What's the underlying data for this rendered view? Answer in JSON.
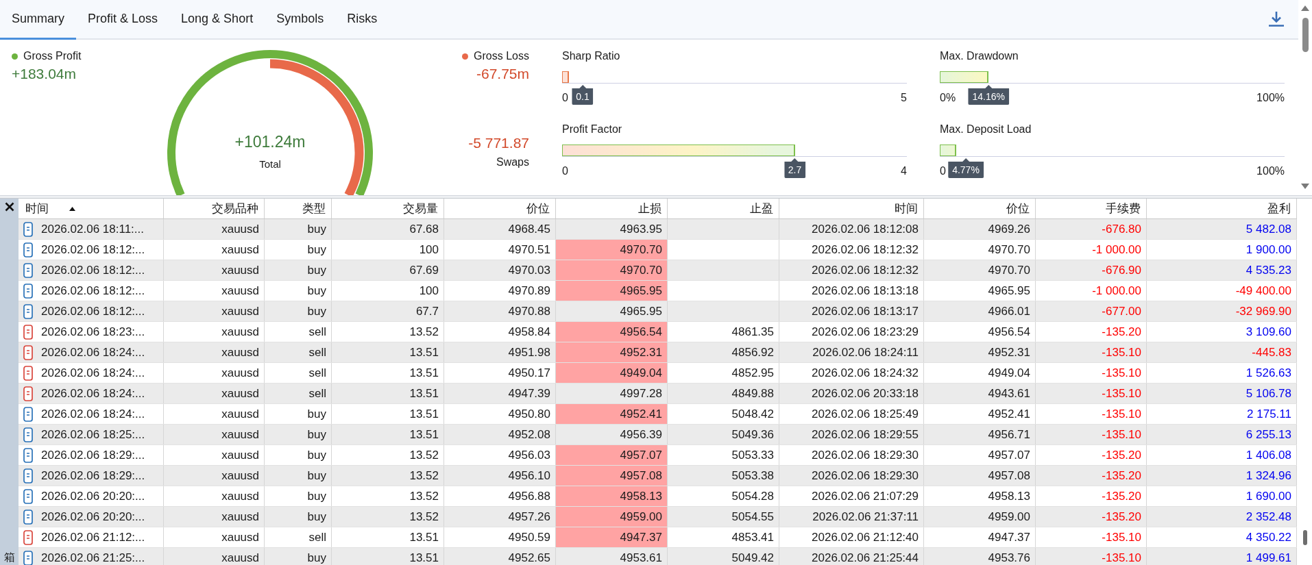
{
  "tabs": [
    {
      "label": "Summary",
      "selected": true
    },
    {
      "label": "Profit & Loss",
      "selected": false
    },
    {
      "label": "Long & Short",
      "selected": false
    },
    {
      "label": "Symbols",
      "selected": false
    },
    {
      "label": "Risks",
      "selected": false
    }
  ],
  "summary": {
    "gross_profit": {
      "label": "Gross Profit",
      "value": "+183.04m"
    },
    "total": {
      "value": "+101.24m",
      "label": "Total"
    },
    "gross_loss": {
      "label": "Gross Loss",
      "value": "-67.75m"
    },
    "swaps": {
      "value": "-5 771.87",
      "label": "Swaps"
    }
  },
  "metrics": [
    {
      "label": "Sharp Ratio",
      "kind": "higher_better",
      "level": 0.02,
      "value": "0.1",
      "min": "0",
      "max": "5"
    },
    {
      "label": "Max. Drawdown",
      "kind": "lower_better",
      "level": 0.1416,
      "value": "14.16%",
      "min": "0%",
      "max": "100%"
    },
    {
      "label": "Profit Factor",
      "kind": "higher_better",
      "level": 0.675,
      "value": "2.7",
      "min": "0",
      "max": "4"
    },
    {
      "label": "Max. Deposit Load",
      "kind": "lower_better",
      "level": 0.0477,
      "value": "4.77%",
      "min": "0",
      "max": "100%"
    }
  ],
  "side_panel": {
    "label": "箱"
  },
  "table": {
    "columns": [
      {
        "label": "时间",
        "sorted": true
      },
      {
        "label": "交易品种",
        "sorted": false
      },
      {
        "label": "类型",
        "sorted": false
      },
      {
        "label": "交易量",
        "sorted": false
      },
      {
        "label": "价位",
        "sorted": false
      },
      {
        "label": "止损",
        "sorted": false
      },
      {
        "label": "止盈",
        "sorted": false
      },
      {
        "label": "时间",
        "sorted": false
      },
      {
        "label": "价位",
        "sorted": false
      },
      {
        "label": "手续费",
        "sorted": false
      },
      {
        "label": "盈利",
        "sorted": false
      }
    ],
    "rows": [
      {
        "kind": "buy",
        "time": "2026.02.06 18:11:...",
        "symbol": "xauusd",
        "type": "buy",
        "volume": "67.68",
        "price": "4968.45",
        "sl": "4963.95",
        "sl_hit": false,
        "close_time": "2026.02.06 18:12:08",
        "close_price": "4969.26",
        "commission": "-676.80",
        "profit": "5 482.08",
        "loss": false
      },
      {
        "kind": "buy",
        "time": "2026.02.06 18:12:...",
        "symbol": "xauusd",
        "type": "buy",
        "volume": "100",
        "price": "4970.51",
        "sl": "4970.70",
        "sl_hit": true,
        "close_time": "2026.02.06 18:12:32",
        "close_price": "4970.70",
        "commission": "-1 000.00",
        "profit": "1 900.00",
        "loss": false
      },
      {
        "kind": "buy",
        "time": "2026.02.06 18:12:...",
        "symbol": "xauusd",
        "type": "buy",
        "volume": "67.69",
        "price": "4970.03",
        "sl": "4970.70",
        "sl_hit": true,
        "close_time": "2026.02.06 18:12:32",
        "close_price": "4970.70",
        "commission": "-676.90",
        "profit": "4 535.23",
        "loss": false
      },
      {
        "kind": "buy",
        "time": "2026.02.06 18:12:...",
        "symbol": "xauusd",
        "type": "buy",
        "volume": "100",
        "price": "4970.89",
        "sl": "4965.95",
        "sl_hit": true,
        "close_time": "2026.02.06 18:13:18",
        "close_price": "4965.95",
        "commission": "-1 000.00",
        "profit": "-49 400.00",
        "loss": true
      },
      {
        "kind": "buy",
        "time": "2026.02.06 18:12:...",
        "symbol": "xauusd",
        "type": "buy",
        "volume": "67.7",
        "price": "4970.88",
        "sl": "4965.95",
        "sl_hit": false,
        "close_time": "2026.02.06 18:13:17",
        "close_price": "4966.01",
        "commission": "-677.00",
        "profit": "-32 969.90",
        "loss": true
      },
      {
        "kind": "sell",
        "time": "2026.02.06 18:23:...",
        "symbol": "xauusd",
        "type": "sell",
        "volume": "13.52",
        "price": "4958.84",
        "sl": "4956.54",
        "sl_hit": true,
        "tp": "4861.35",
        "close_time": "2026.02.06 18:23:29",
        "close_price": "4956.54",
        "commission": "-135.20",
        "profit": "3 109.60",
        "loss": false
      },
      {
        "kind": "sell",
        "time": "2026.02.06 18:24:...",
        "symbol": "xauusd",
        "type": "sell",
        "volume": "13.51",
        "price": "4951.98",
        "sl": "4952.31",
        "sl_hit": true,
        "tp": "4856.92",
        "close_time": "2026.02.06 18:24:11",
        "close_price": "4952.31",
        "commission": "-135.10",
        "profit": "-445.83",
        "loss": true
      },
      {
        "kind": "sell",
        "time": "2026.02.06 18:24:...",
        "symbol": "xauusd",
        "type": "sell",
        "volume": "13.51",
        "price": "4950.17",
        "sl": "4949.04",
        "sl_hit": true,
        "tp": "4852.95",
        "close_time": "2026.02.06 18:24:32",
        "close_price": "4949.04",
        "commission": "-135.10",
        "profit": "1 526.63",
        "loss": false
      },
      {
        "kind": "sell",
        "time": "2026.02.06 18:24:...",
        "symbol": "xauusd",
        "type": "sell",
        "volume": "13.51",
        "price": "4947.39",
        "sl": "4997.28",
        "sl_hit": false,
        "tp": "4849.88",
        "close_time": "2026.02.06 20:33:18",
        "close_price": "4943.61",
        "commission": "-135.10",
        "profit": "5 106.78",
        "loss": false
      },
      {
        "kind": "buy",
        "time": "2026.02.06 18:24:...",
        "symbol": "xauusd",
        "type": "buy",
        "volume": "13.51",
        "price": "4950.80",
        "sl": "4952.41",
        "sl_hit": true,
        "tp": "5048.42",
        "close_time": "2026.02.06 18:25:49",
        "close_price": "4952.41",
        "commission": "-135.10",
        "profit": "2 175.11",
        "loss": false
      },
      {
        "kind": "buy",
        "time": "2026.02.06 18:25:...",
        "symbol": "xauusd",
        "type": "buy",
        "volume": "13.51",
        "price": "4952.08",
        "sl": "4956.39",
        "sl_hit": false,
        "tp": "5049.36",
        "close_time": "2026.02.06 18:29:55",
        "close_price": "4956.71",
        "commission": "-135.10",
        "profit": "6 255.13",
        "loss": false
      },
      {
        "kind": "buy",
        "time": "2026.02.06 18:29:...",
        "symbol": "xauusd",
        "type": "buy",
        "volume": "13.52",
        "price": "4956.03",
        "sl": "4957.07",
        "sl_hit": true,
        "tp": "5053.33",
        "close_time": "2026.02.06 18:29:30",
        "close_price": "4957.07",
        "commission": "-135.20",
        "profit": "1 406.08",
        "loss": false
      },
      {
        "kind": "buy",
        "time": "2026.02.06 18:29:...",
        "symbol": "xauusd",
        "type": "buy",
        "volume": "13.52",
        "price": "4956.10",
        "sl": "4957.08",
        "sl_hit": true,
        "tp": "5053.38",
        "close_time": "2026.02.06 18:29:30",
        "close_price": "4957.08",
        "commission": "-135.20",
        "profit": "1 324.96",
        "loss": false
      },
      {
        "kind": "buy",
        "time": "2026.02.06 20:20:...",
        "symbol": "xauusd",
        "type": "buy",
        "volume": "13.52",
        "price": "4956.88",
        "sl": "4958.13",
        "sl_hit": true,
        "tp": "5054.28",
        "close_time": "2026.02.06 21:07:29",
        "close_price": "4958.13",
        "commission": "-135.20",
        "profit": "1 690.00",
        "loss": false
      },
      {
        "kind": "buy",
        "time": "2026.02.06 20:20:...",
        "symbol": "xauusd",
        "type": "buy",
        "volume": "13.52",
        "price": "4957.26",
        "sl": "4959.00",
        "sl_hit": true,
        "tp": "5054.55",
        "close_time": "2026.02.06 21:37:11",
        "close_price": "4959.00",
        "commission": "-135.20",
        "profit": "2 352.48",
        "loss": false
      },
      {
        "kind": "sell",
        "time": "2026.02.06 21:12:...",
        "symbol": "xauusd",
        "type": "sell",
        "volume": "13.51",
        "price": "4950.59",
        "sl": "4947.37",
        "sl_hit": true,
        "tp": "4853.41",
        "close_time": "2026.02.06 21:12:40",
        "close_price": "4947.37",
        "commission": "-135.10",
        "profit": "4 350.22",
        "loss": false
      },
      {
        "kind": "buy",
        "time": "2026.02.06 21:25:...",
        "symbol": "xauusd",
        "type": "buy",
        "volume": "13.51",
        "price": "4952.65",
        "sl": "4953.61",
        "sl_hit": false,
        "tp": "5049.42",
        "close_time": "2026.02.06 21:25:44",
        "close_price": "4953.76",
        "commission": "-135.10",
        "profit": "1 499.61",
        "loss": false
      }
    ]
  }
}
